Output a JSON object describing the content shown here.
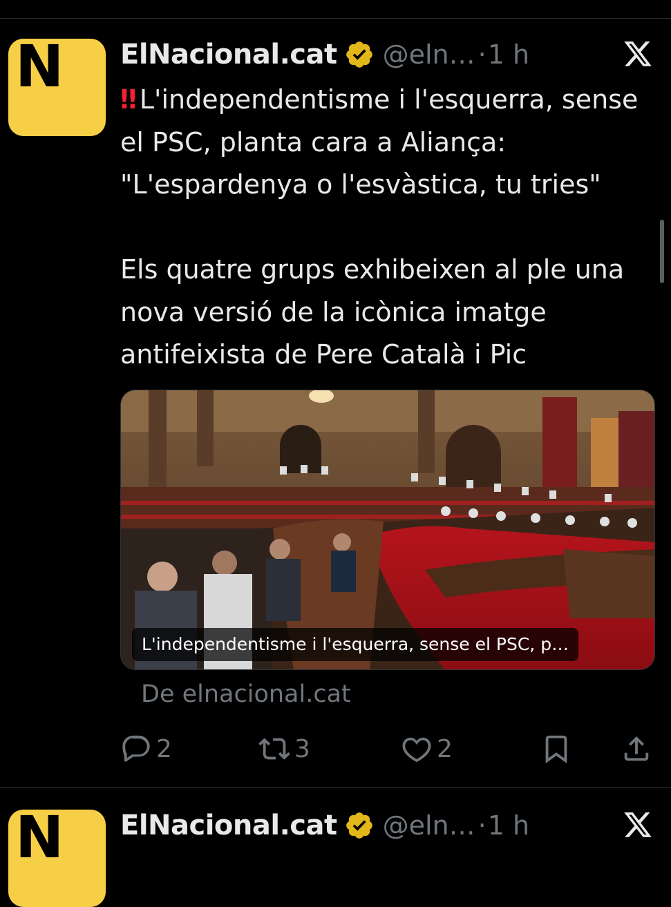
{
  "tweets": [
    {
      "author_name": "ElNacional.cat",
      "handle": "@eln…",
      "separator": "·",
      "time": "1 h",
      "avatar_letter": "N",
      "alert_emoji": "‼",
      "text_title": "L'independentisme i l'esquerra, sense el PSC, planta cara a Aliança: \"L'espardenya o l'esvàstica, tu tries\"",
      "text_body": "Els quatre grups exhibeixen al ple una nova versió de la icònica imatge antifeixista de Pere Català i Pic",
      "card_caption": "L'independentisme i l'esquerra, sense el PSC, p…",
      "source": "De elnacional.cat",
      "reply_count": "2",
      "repost_count": "3",
      "like_count": "2"
    },
    {
      "author_name": "ElNacional.cat",
      "handle": "@eln…",
      "separator": "·",
      "time": "1 h",
      "avatar_letter": "N"
    }
  ],
  "icons": {
    "verified": "verified-badge-icon",
    "platform": "x-logo-icon",
    "reply": "reply-icon",
    "repost": "repost-icon",
    "like": "like-icon",
    "bookmark": "bookmark-icon",
    "share": "share-icon"
  },
  "colors": {
    "background": "#000000",
    "text": "#e7e9ea",
    "secondary": "#71767b",
    "avatar": "#f7cf46",
    "verified": "#e2b719",
    "alert": "#f4212e"
  }
}
